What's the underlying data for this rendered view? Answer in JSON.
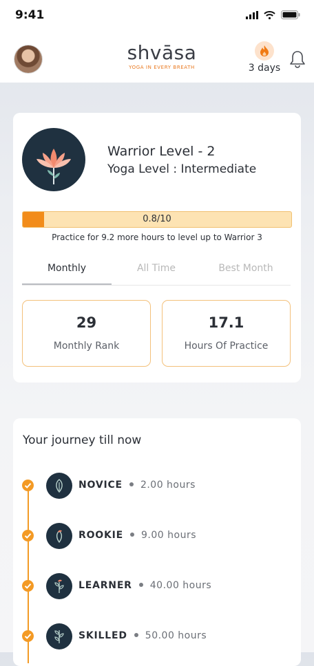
{
  "status_bar": {
    "time": "9:41"
  },
  "header": {
    "logo_text": "shvāsa",
    "logo_tagline": "YOGA IN EVERY BREATH",
    "streak_text": "3 days"
  },
  "level": {
    "title": "Warrior Level - 2",
    "subtitle": "Yoga Level : Intermediate",
    "progress_text": "0.8/10",
    "progress_fraction": 0.08,
    "hint": "Practice for 9.2 more hours to level up to Warrior 3"
  },
  "tabs": [
    {
      "label": "Monthly",
      "active": true
    },
    {
      "label": "All Time",
      "active": false
    },
    {
      "label": "Best Month",
      "active": false
    }
  ],
  "stats": [
    {
      "value": "29",
      "label": "Monthly Rank"
    },
    {
      "value": "17.1",
      "label": "Hours Of Practice"
    }
  ],
  "journey": {
    "title": "Your journey till now",
    "levels": [
      {
        "name": "NOVICE",
        "hours": "2.00 hours",
        "icon": "seed-icon"
      },
      {
        "name": "ROOKIE",
        "hours": "9.00 hours",
        "icon": "bud-icon"
      },
      {
        "name": "LEARNER",
        "hours": "40.00 hours",
        "icon": "sprout-icon"
      },
      {
        "name": "SKILLED",
        "hours": "50.00 hours",
        "icon": "plant-icon"
      }
    ]
  },
  "colors": {
    "accent": "#f39a25",
    "dark_badge": "#1f3140",
    "progress_bg": "#fde3b3"
  }
}
